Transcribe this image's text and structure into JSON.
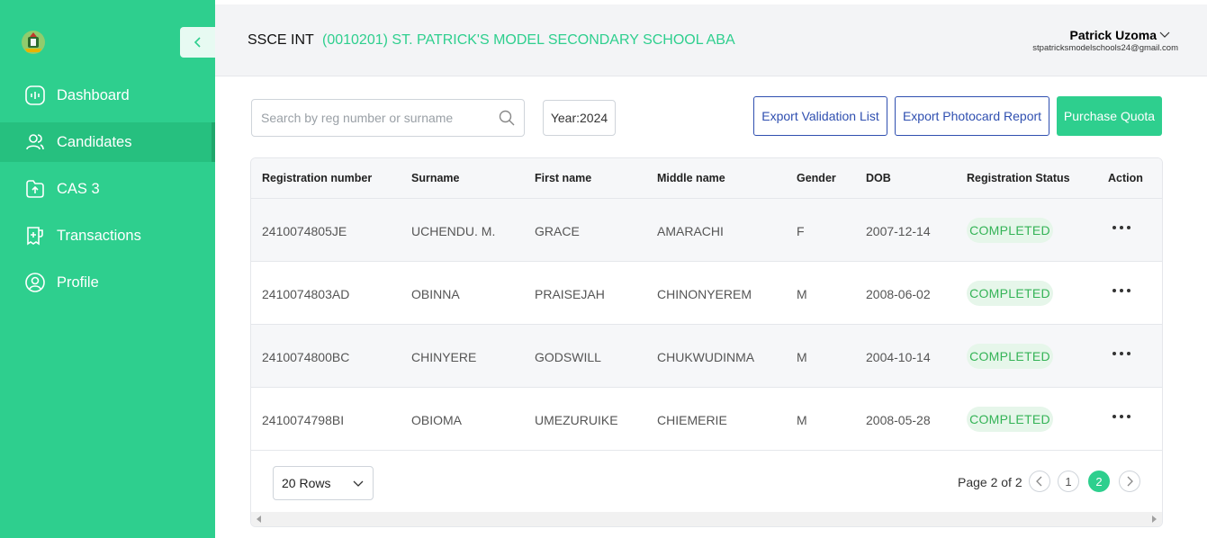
{
  "sidebar": {
    "items": [
      {
        "label": "Dashboard",
        "icon": "dashboard-icon"
      },
      {
        "label": "Candidates",
        "icon": "users-icon"
      },
      {
        "label": "CAS 3",
        "icon": "upload-folder-icon"
      },
      {
        "label": "Transactions",
        "icon": "receipt-icon"
      },
      {
        "label": "Profile",
        "icon": "user-circle-icon"
      }
    ],
    "active_index": 1
  },
  "header": {
    "exam": "SSCE INT",
    "school": "(0010201) ST. PATRICK'S MODEL SECONDARY SCHOOL ABA",
    "user_name": "Patrick Uzoma",
    "user_email": "stpatricksmodelschools24@gmail.com"
  },
  "toolbar": {
    "search_placeholder": "Search by reg number or surname",
    "year_label": "Year:",
    "year_value": "2024",
    "export_validation": "Export Validation List",
    "export_photocard": "Export Photocard Report",
    "purchase_quota": "Purchase Quota"
  },
  "table": {
    "columns": [
      "Registration number",
      "Surname",
      "First name",
      "Middle name",
      "Gender",
      "DOB",
      "Registration Status",
      "Action"
    ],
    "rows": [
      {
        "reg": "2410074805JE",
        "surname": "UCHENDU. M.",
        "first": "GRACE",
        "middle": "AMARACHI",
        "gender": "F",
        "dob": "2007-12-14",
        "status": "COMPLETED"
      },
      {
        "reg": "2410074803AD",
        "surname": "OBINNA",
        "first": "PRAISEJAH",
        "middle": "CHINONYEREM",
        "gender": "M",
        "dob": "2008-06-02",
        "status": "COMPLETED"
      },
      {
        "reg": "2410074800BC",
        "surname": "CHINYERE",
        "first": "GODSWILL",
        "middle": "CHUKWUDINMA",
        "gender": "M",
        "dob": "2004-10-14",
        "status": "COMPLETED"
      },
      {
        "reg": "2410074798BI",
        "surname": "OBIOMA",
        "first": "UMEZURUIKE",
        "middle": "CHIEMERIE",
        "gender": "M",
        "dob": "2008-05-28",
        "status": "COMPLETED"
      }
    ]
  },
  "pagination": {
    "rows_option": "20 Rows",
    "page_label": "Page 2 of 2",
    "pages": [
      "1",
      "2"
    ],
    "current_page": "2"
  },
  "colors": {
    "brand": "#2ecf8e",
    "button_outline": "#2f4fb0",
    "status_text": "#34b356",
    "status_bg": "#e6f6ea"
  }
}
